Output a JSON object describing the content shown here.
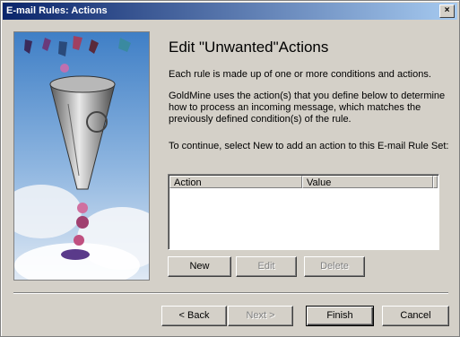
{
  "window": {
    "title": "E-mail Rules: Actions",
    "close_label": "×"
  },
  "heading": "Edit \"Unwanted\"Actions",
  "paragraphs": {
    "p1": "Each rule is made up of one or more conditions and actions.",
    "p2": "GoldMine uses the action(s) that you define below to determine how to process an incoming message, which matches the previously defined condition(s) of the rule.",
    "p3": "To continue, select New to add an action to this E-mail Rule Set:"
  },
  "table": {
    "columns": [
      "Action",
      "Value"
    ],
    "rows": []
  },
  "list_buttons": {
    "new": "New",
    "edit": "Edit",
    "delete": "Delete"
  },
  "nav_buttons": {
    "back": "< Back",
    "next": "Next >",
    "finish": "Finish",
    "cancel": "Cancel"
  }
}
